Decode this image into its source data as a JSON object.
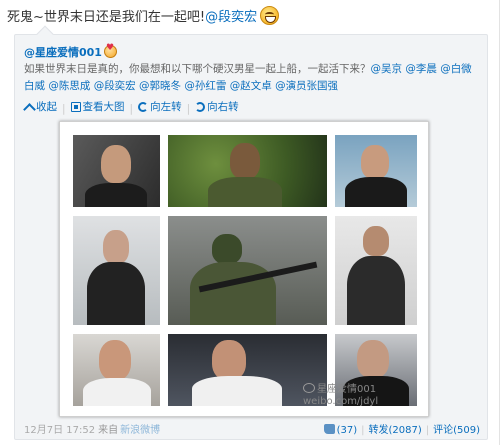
{
  "post": {
    "text_prefix": "死鬼~世界末日还是我们在一起吧!",
    "mention": "@段奕宏",
    "emoji": "smile-emoji"
  },
  "repost": {
    "author": "@星座爱情001",
    "author_emoji": "heart-emoji",
    "text": "如果世界末日是真的，你最想和以下哪个硬汉男星一起上船，一起活下来？",
    "mentions_line1": [
      "@吴京",
      "@李晨",
      "@白微"
    ],
    "text_line2_prefix": "白威",
    "mentions_line2": [
      "@陈思成",
      "@段奕宏",
      "@郭晓冬",
      "@孙红雷",
      "@赵文卓",
      "@演员张国强"
    ],
    "image_tools": {
      "collapse": "收起",
      "view_large": "查看大图",
      "rotate_left": "向左转",
      "rotate_right": "向右转"
    },
    "watermark_line1": "星座爱情001",
    "watermark_line2": "weibo.com/jdyl",
    "footer": {
      "time": "12月7日 17:52",
      "via_label": "来自",
      "via_source": "新浪微博",
      "likes": "(37)",
      "repost_label": "转发(2087)",
      "comment_label": "评论(509)"
    }
  },
  "colors": {
    "link": "#0a6ebd",
    "repost_bg": "#f2f4f6",
    "muted_text": "#666666"
  }
}
